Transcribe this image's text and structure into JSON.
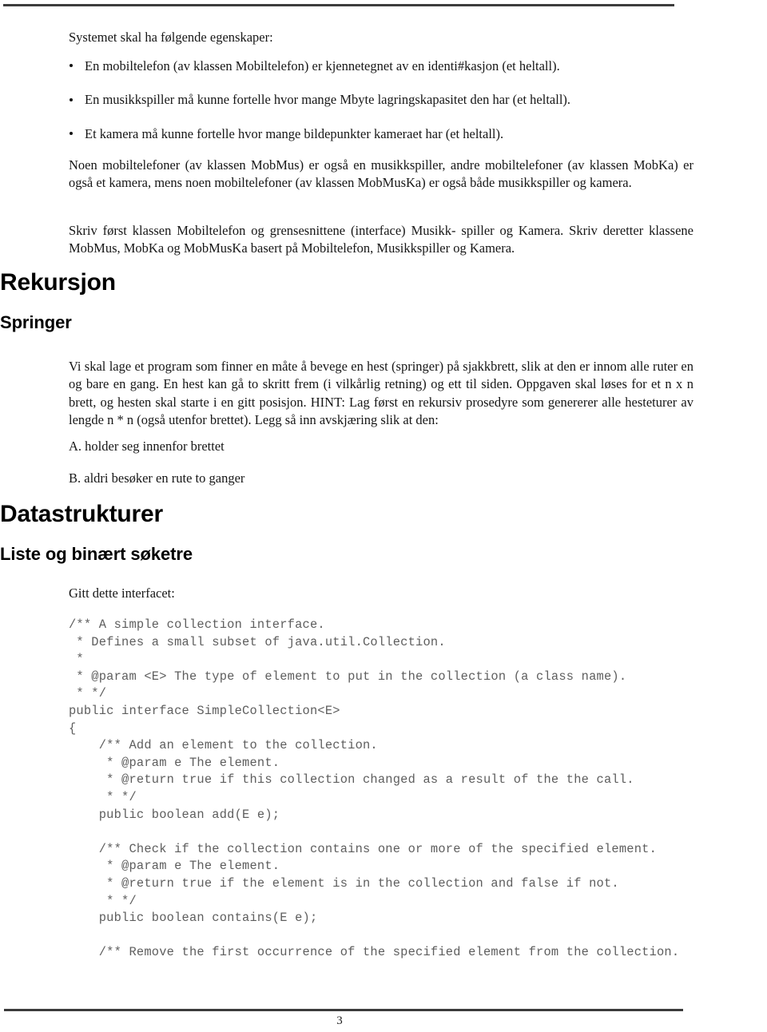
{
  "document": {
    "page_number": "3",
    "intro_line": "Systemet skal ha følgende egenskaper:",
    "requirements": [
      "En mobiltelefon (av klassen Mobiltelefon) er kjennetegnet av en identi#kasjon (et heltall).",
      "En musikkspiller må kunne fortelle hvor mange Mbyte lagringskapasitet den har (et heltall).",
      "Et kamera må kunne fortelle hvor mange bildepunkter kameraet har (et heltall)."
    ],
    "paragraph_classes": "Noen mobiltelefoner (av klassen MobMus) er også en musikkspiller, andre mobiltelefoner (av klassen MobKa) er også et kamera, mens noen mobiltelefoner (av klassen MobMusKa) er også både musikkspiller og kamera.",
    "paragraph_task": "Skriv først klassen Mobiltelefon og grensesnittene (interface) Musikk- spiller og Kamera. Skriv deretter klassene MobMus, MobKa og MobMusKa basert på Mobiltelefon, Musikkspiller og Kamera.",
    "heading_rekursjon": "Rekursjon",
    "heading_springer": "Springer",
    "paragraph_springer": "Vi skal lage et program som finner en måte å bevege en hest (springer) på sjakkbrett, slik at den er innom alle ruter en og bare en gang. En hest kan gå to skritt frem (i vilkårlig retning) og ett til siden. Oppgaven skal løses for et n x n brett, og hesten skal starte i en gitt posisjon. HINT: Lag først en rekursiv prosedyre som genererer alle hesteturer av lengde n * n (også utenfor brettet). Legg så inn avskjæring slik at den:",
    "item_a": "A. holder seg innenfor brettet",
    "item_b": "B. aldri besøker en rute to ganger",
    "heading_datastrukturer": "Datastrukturer",
    "heading_liste": "Liste og binært søketre",
    "gitt_line": "Gitt dette interfacet:",
    "code_block": "/** A simple collection interface.\n * Defines a small subset of java.util.Collection.\n *\n * @param <E> The type of element to put in the collection (a class name).\n * */\npublic interface SimpleCollection<E>\n{\n    /** Add an element to the collection.\n     * @param e The element.\n     * @return true if this collection changed as a result of the the call.\n     * */\n    public boolean add(E e);\n\n    /** Check if the collection contains one or more of the specified element.\n     * @param e The element.\n     * @return true if the element is in the collection and false if not.\n     * */\n    public boolean contains(E e);\n\n    /** Remove the first occurrence of the specified element from the collection."
  },
  "colors": {
    "rule": "#3c3c3c",
    "body_text": "#161616",
    "heading_text": "#000000",
    "code_text": "#5e5e5e",
    "page_background": "#ffffff"
  }
}
